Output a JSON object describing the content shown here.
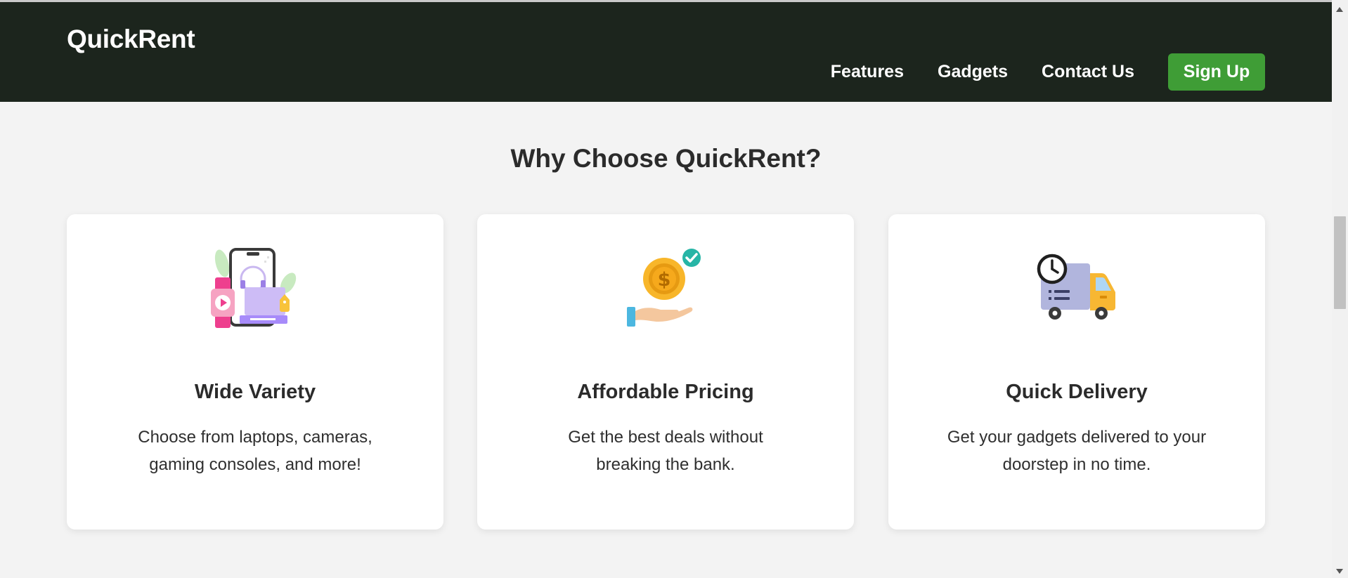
{
  "header": {
    "brand": "QuickRent",
    "nav": [
      "Features",
      "Gadgets",
      "Contact Us"
    ],
    "signup_label": "Sign Up"
  },
  "section": {
    "title": "Why Choose QuickRent?",
    "cards": [
      {
        "title": "Wide Variety",
        "text": "Choose from laptops, cameras, gaming consoles, and more!",
        "icon": "gadgets-icon"
      },
      {
        "title": "Affordable Pricing",
        "text": "Get the best deals without breaking the bank.",
        "icon": "coin-hand-icon"
      },
      {
        "title": "Quick Delivery",
        "text": "Get your gadgets delivered to your doorstep in no time.",
        "icon": "delivery-truck-icon"
      }
    ]
  },
  "colors": {
    "header_bg": "#1c251d",
    "accent": "#3f9d36",
    "page_bg": "#f3f3f3"
  }
}
